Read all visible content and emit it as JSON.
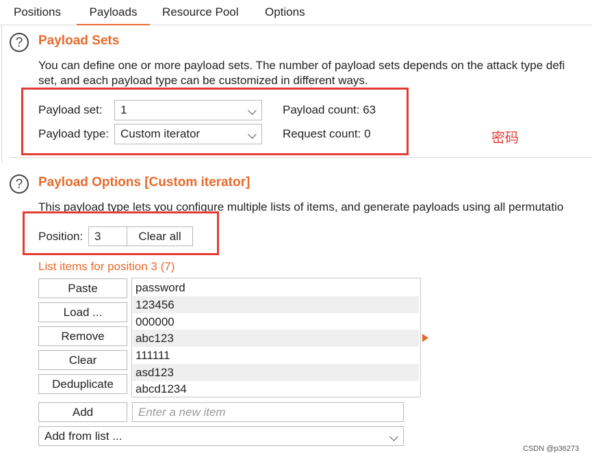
{
  "tabs": [
    {
      "label": "Positions"
    },
    {
      "label": "Payloads"
    },
    {
      "label": "Resource Pool"
    },
    {
      "label": "Options"
    }
  ],
  "payload_sets": {
    "title": "Payload Sets",
    "description_line1": "You can define one or more payload sets. The number of payload sets depends on the attack type defi",
    "description_line2": "set, and each payload type can be customized in different ways.",
    "set_label": "Payload set:",
    "set_value": "1",
    "type_label": "Payload type:",
    "type_value": "Custom iterator",
    "payload_count": "Payload count: 63",
    "request_count": "Request count: 0",
    "annotation": "密码"
  },
  "payload_options": {
    "title": "Payload Options [Custom iterator]",
    "description": "This payload type lets you configure multiple lists of items, and generate payloads using all permutatio",
    "position_label": "Position:",
    "position_value": "3",
    "clear_all_label": "Clear all",
    "list_heading": "List items for position 3 (7)",
    "buttons": {
      "paste": "Paste",
      "load": "Load ...",
      "remove": "Remove",
      "clear": "Clear",
      "deduplicate": "Deduplicate",
      "add": "Add"
    },
    "items": [
      "password",
      "123456",
      "000000",
      "abc123",
      "111111",
      "asd123",
      "abcd1234"
    ],
    "new_item_placeholder": "Enter a new item",
    "add_from_list_label": "Add from list ..."
  },
  "watermark": "CSDN @p36273",
  "colors": {
    "accent": "#e8692c",
    "highlight_box": "#e53935"
  }
}
